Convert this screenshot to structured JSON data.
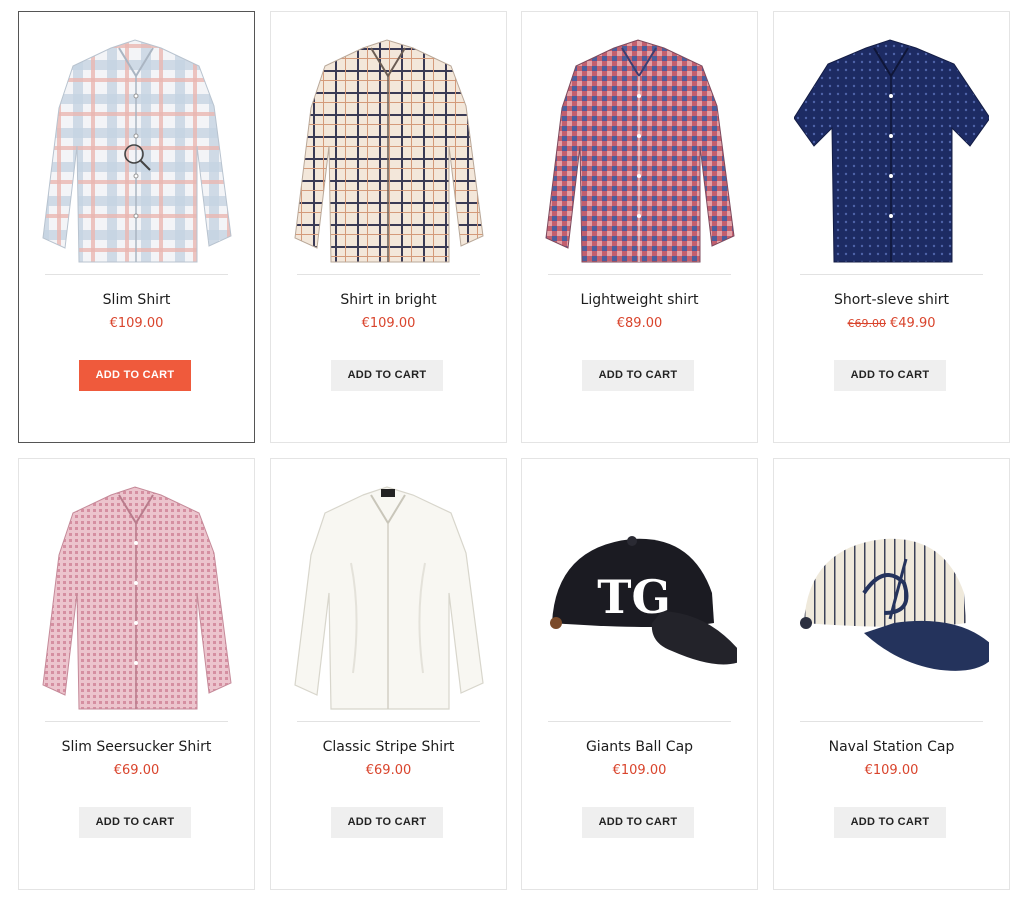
{
  "products": [
    {
      "name": "Slim Shirt",
      "price": "€109.00",
      "old_price": "",
      "button": "ADD TO CART",
      "icon": "plaid-shirt-light-icon",
      "color": "#c7d3e0",
      "accent": "#e9b9b4"
    },
    {
      "name": "Shirt in bright",
      "price": "€109.00",
      "old_price": "",
      "button": "ADD TO CART",
      "icon": "check-shirt-icon",
      "color": "#f1e6da",
      "accent": "#3a3a55"
    },
    {
      "name": "Lightweight shirt",
      "price": "€89.00",
      "old_price": "",
      "button": "ADD TO CART",
      "icon": "gingham-shirt-icon",
      "color": "#a75a78",
      "accent": "#4b5e9c"
    },
    {
      "name": "Short-sleve shirt",
      "price": "€49.90",
      "old_price": "€69.00",
      "button": "ADD TO CART",
      "icon": "navy-shortsleeve-shirt-icon",
      "color": "#1f2e66",
      "accent": "#3c4f8f"
    },
    {
      "name": "Slim Seersucker Shirt",
      "price": "€69.00",
      "old_price": "",
      "button": "ADD TO CART",
      "icon": "pink-shirt-icon",
      "color": "#e4b1be",
      "accent": "#cf8d9e"
    },
    {
      "name": "Classic Stripe Shirt",
      "price": "€69.00",
      "old_price": "",
      "button": "ADD TO CART",
      "icon": "white-shirt-icon",
      "color": "#f7f6f1",
      "accent": "#dddbd3"
    },
    {
      "name": "Giants Ball Cap",
      "price": "€109.00",
      "old_price": "",
      "button": "ADD TO CART",
      "icon": "black-cap-icon",
      "color": "#1b1b22",
      "accent": "#ffffff"
    },
    {
      "name": "Naval Station Cap",
      "price": "€109.00",
      "old_price": "",
      "button": "ADD TO CART",
      "icon": "pinstripe-cap-icon",
      "color": "#efeadd",
      "accent": "#23325a"
    }
  ],
  "accent_color": "#ef5a3c",
  "price_color": "#d9442c"
}
